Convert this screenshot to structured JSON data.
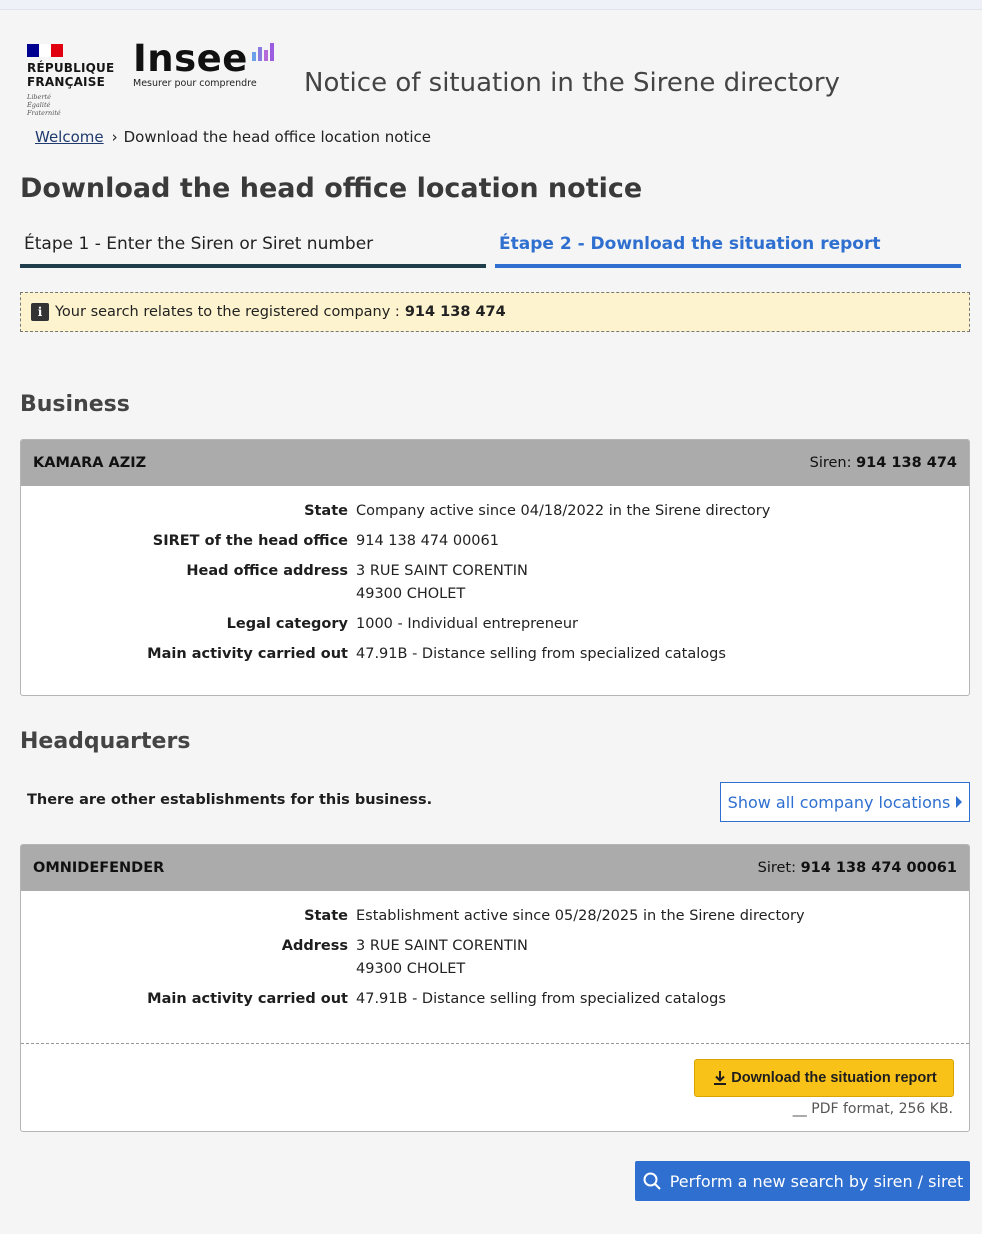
{
  "header": {
    "republic_line1": "RÉPUBLIQUE",
    "republic_line2": "FRANÇAISE",
    "motto": [
      "Liberté",
      "Égalité",
      "Fraternité"
    ],
    "insee_name": "Insee",
    "insee_tagline": "Mesurer pour comprendre",
    "site_title": "Notice of situation in the Sirene directory"
  },
  "breadcrumb": {
    "home": "Welcome",
    "current": "Download the head office location notice"
  },
  "page_title": "Download the head office location notice",
  "steps": [
    {
      "label": "Étape 1 - Enter the Siren or Siret number"
    },
    {
      "label": "Étape 2 - Download the situation report"
    }
  ],
  "notice": {
    "text": "Your search relates to the registered company :",
    "value": "914 138 474"
  },
  "business": {
    "section_title": "Business",
    "name": "KAMARA AZIZ",
    "id_label": "Siren:",
    "id_value": "914 138 474",
    "fields": [
      {
        "label": "State",
        "value": "Company active since 04/18/2022 in the Sirene directory"
      },
      {
        "label": "SIRET of the head office",
        "value": "914 138 474 00061"
      },
      {
        "label": "Head office address",
        "value": "3 RUE SAINT CORENTIN",
        "value2": "49300 CHOLET"
      },
      {
        "label": "Legal category",
        "value": "1000 - Individual entrepreneur"
      },
      {
        "label": "Main activity carried out",
        "value": "47.91B - Distance selling from specialized catalogs"
      }
    ]
  },
  "headquarters": {
    "section_title": "Headquarters",
    "other_text": "There are other establishments for this business.",
    "show_all_label": "Show all company locations",
    "name": "OMNIDEFENDER",
    "id_label": "Siret:",
    "id_value": "914 138 474 00061",
    "fields": [
      {
        "label": "State",
        "value": "Establishment active since 05/28/2025 in the Sirene directory"
      },
      {
        "label": "Address",
        "value": "3 RUE SAINT CORENTIN",
        "value2": "49300 CHOLET"
      },
      {
        "label": "Main activity carried out",
        "value": "47.91B - Distance selling from specialized catalogs"
      }
    ],
    "download_label": "Download the situation report",
    "pdf_info": "__ PDF format, 256 KB."
  },
  "new_search_label": "Perform a new search by siren / siret",
  "colors": {
    "primary": "#2e6fd0",
    "download": "#f9c218",
    "notice_bg": "#fdf4cf",
    "card_head": "#ababab"
  }
}
